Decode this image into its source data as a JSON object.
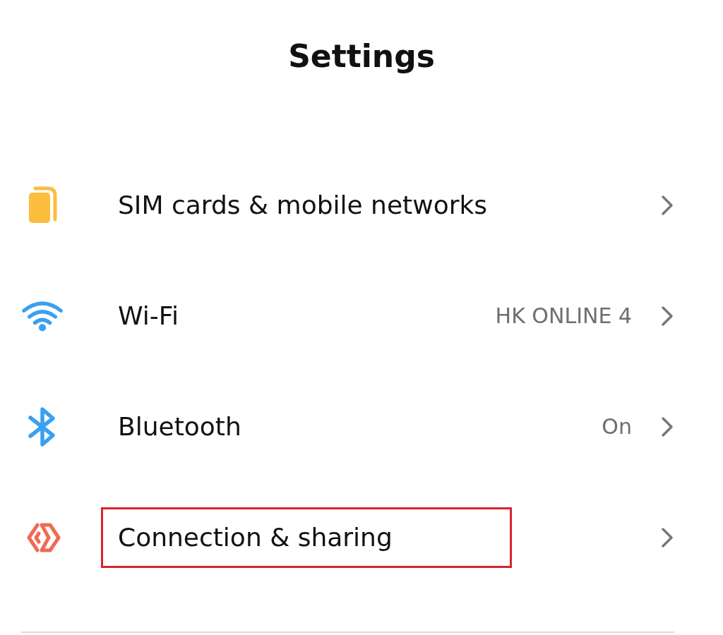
{
  "title": "Settings",
  "items": [
    {
      "kind": "sim",
      "label": "SIM cards & mobile networks",
      "highlighted": false
    },
    {
      "kind": "wifi",
      "label": "Wi-Fi",
      "value": "HK ONLINE 4",
      "highlighted": false
    },
    {
      "kind": "bluetooth",
      "label": "Bluetooth",
      "value": "On",
      "highlighted": false
    },
    {
      "kind": "connection",
      "label": "Connection & sharing",
      "highlighted": true
    }
  ]
}
